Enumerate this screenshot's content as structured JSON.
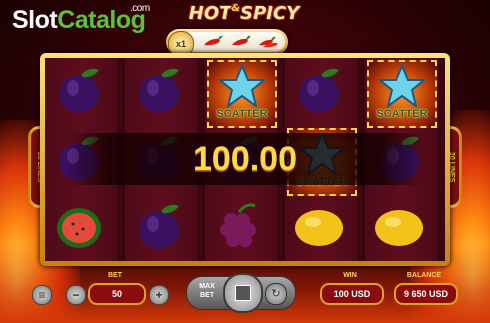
{
  "branding": {
    "logo_part1": "Slot",
    "logo_part2": "Catalog",
    "logo_suffix": ".com"
  },
  "game": {
    "title_left": "HOT",
    "title_amp": "&",
    "title_right": "SPICY",
    "multiplier": "x1",
    "lines_left": "20 LINES",
    "lines_right": "20 LINES"
  },
  "reels": {
    "symbols": [
      [
        "plum",
        "plum",
        "scatter",
        "plum",
        "scatter"
      ],
      [
        "plum",
        "plum",
        "plum",
        "scatter",
        "plum"
      ],
      [
        "watermelon",
        "plum",
        "grapes",
        "lemon",
        "lemon"
      ]
    ],
    "scatter_label": "SCATTER"
  },
  "win": {
    "amount": "100.00"
  },
  "controls": {
    "bet_label": "BET",
    "bet_value": "50",
    "minus_symbol": "−",
    "plus_symbol": "+",
    "menu_symbol": "≡",
    "maxbet_label_1": "MAX",
    "maxbet_label_2": "BET",
    "auto_symbol": "↻",
    "win_label": "WIN",
    "win_value": "100 USD",
    "balance_label": "BALANCE",
    "balance_value": "9 650 USD"
  },
  "colors": {
    "gold": "#ffd74a",
    "frame": "#e0a028",
    "reel_bg": "#5e0d1e",
    "logo_green": "#5cc236"
  }
}
